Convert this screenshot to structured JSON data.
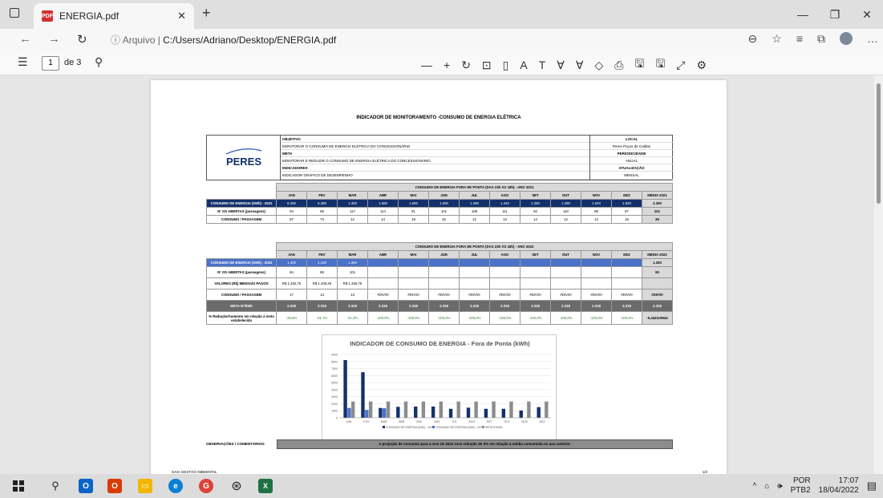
{
  "browser": {
    "tab_title": "ENERGIA.pdf",
    "url_prefix": "Arquivo",
    "url_path": "C:/Users/Adriano/Desktop/ENERGIA.pdf"
  },
  "pdf_toolbar": {
    "page_current": "1",
    "page_total": "de 3"
  },
  "document": {
    "title": "INDICADOR DE MONITORAMENTO -CONSUMO DE ENERGIA ELÉTRICA",
    "logo_text": "PERES",
    "header": {
      "objetivo_label": "OBJETIVO",
      "objetivo": "MONITORAR O CONSUMO DE ENERGIA ELÉTRICA DO CONCESSIONÁRIO",
      "meta_label": "META",
      "meta": "MONITORAR E REDUZIR O CONSUMO DE ENERGIA ELÉTRICA DO CONCESSIONÁRIO",
      "indicadores_label": "INDICADORES",
      "indicadores": "INDICADOR GRÁFICO DE DESEMPENHO",
      "local_label": "LOCAL",
      "local": "Peres Poços de Caldas",
      "periodicidade_label": "PERIODICIDADE",
      "periodicidade": "ANUAL",
      "atualizacao_label": "ATUALIZAÇÃO",
      "atualizacao": "MENSAL"
    },
    "table2021": {
      "caption": "CONSUMO DE ENERGIA FORA DE PONTA (DAS 23h ÀS 18h) - ANO 2021",
      "months": [
        "JAN",
        "FEV",
        "MAR",
        "ABR",
        "MAI",
        "JUN",
        "JUL",
        "AGO",
        "SET",
        "OUT",
        "NOV",
        "DEZ",
        "MÉDIA 2021"
      ],
      "rows": [
        {
          "label": "CONSUMO DE ENERGIA (kWh) - 2021",
          "values": [
            "8.200",
            "6.480",
            "1.400",
            "1.560",
            "1.600",
            "1.600",
            "1.280",
            "1.440",
            "1.280",
            "1.280",
            "1.040",
            "1.520",
            "2.390"
          ]
        },
        {
          "label": "Nº OS ABERTAS (passagens)",
          "values": [
            "94",
            "89",
            "117",
            "114",
            "91",
            "101",
            "108",
            "111",
            "92",
            "110",
            "88",
            "97",
            "101"
          ]
        },
        {
          "label": "CONSUMO / PASSAGEM",
          "values": [
            "87",
            "73",
            "12",
            "14",
            "18",
            "16",
            "12",
            "13",
            "14",
            "12",
            "12",
            "16",
            "25"
          ]
        }
      ]
    },
    "table2022": {
      "caption": "CONSUMO DE ENERGIA FORA DE PONTA (DAS 23h ÀS 18h) - ANO 2022",
      "months": [
        "JAN",
        "FEV",
        "MAR",
        "ABR",
        "MAI",
        "JUN",
        "JUL",
        "AGO",
        "SET",
        "OUT",
        "NOV",
        "DEZ",
        "MÉDIA 2022"
      ],
      "rows": [
        {
          "label": "CONSUMO DE ENERGIA (kWh) - 2022",
          "values": [
            "1.400",
            "1.120",
            "1.360",
            "",
            "",
            "",
            "",
            "",
            "",
            "",
            "",
            "",
            "1.293"
          ]
        },
        {
          "label": "Nº OS ABERTAS (passagens)",
          "values": [
            "84",
            "85",
            "101",
            "",
            "",
            "",
            "",
            "",
            "",
            "",
            "",
            "",
            "90"
          ]
        },
        {
          "label": "VALORES (R$) MENSAIS PAGOS",
          "values": [
            "R$ 1.482,70",
            "R$ 1.209,26",
            "R$ 1.455,76",
            "",
            "",
            "",
            "",
            "",
            "",
            "",
            "",
            "",
            ""
          ]
        },
        {
          "label": "CONSUMO / PASSAGEM",
          "values": [
            "17",
            "13",
            "13",
            "#DIV/0!",
            "#DIV/0!",
            "#DIV/0!",
            "#DIV/0!",
            "#DIV/0!",
            "#DIV/0!",
            "#DIV/0!",
            "#DIV/0!",
            "#DIV/0!",
            "#DIV/0!"
          ]
        },
        {
          "label": "META Nº/kWh",
          "values": [
            "2.318",
            "2.318",
            "2.318",
            "2.318",
            "2.318",
            "2.318",
            "2.318",
            "2.318",
            "2.318",
            "2.318",
            "2.318",
            "2.318",
            "2.318"
          ]
        },
        {
          "label": "% Redução/Aumento em relação à meta estabelecida",
          "values": [
            "-39,6%",
            "-51,7%",
            "-41,3%",
            "-100,0%",
            "-100,0%",
            "-100,0%",
            "-100,0%",
            "-100,0%",
            "-100,0%",
            "-100,0%",
            "-100,0%",
            "-100,0%",
            "-0,442119944"
          ]
        }
      ]
    },
    "observacoes_label": "OBSERVAÇÕES / COMENTÁRIOS:",
    "observacoes": "A projeção de consumo para o Ano de 2022 será redução de 3% em relação à média consumida no ano anterior.",
    "footer": "GAIA GESTÃO AMBIENTAL",
    "page_number": "1/3"
  },
  "chart_data": {
    "type": "bar",
    "title": "INDICADOR DE CONSUMO DE ENERGIA - Fora de Ponta (kWh)",
    "categories": [
      "JAN",
      "FEV",
      "MAR",
      "ABR",
      "MAI",
      "JUN",
      "JUL",
      "AGO",
      "SET",
      "OUT",
      "NOV",
      "DEZ"
    ],
    "ylim": [
      0,
      9000
    ],
    "yticks": [
      "0",
      "1000",
      "2000",
      "3000",
      "4000",
      "5000",
      "6000",
      "7000",
      "8000",
      "9000"
    ],
    "series": [
      {
        "name": "CONSUMO DE ENERGIA (kWh) - 2021",
        "color": "#13306b",
        "values": [
          8200,
          6480,
          1400,
          1560,
          1600,
          1600,
          1280,
          1440,
          1280,
          1280,
          1040,
          1520
        ]
      },
      {
        "name": "CONSUMO DE ENERGIA (kWh) - 2022",
        "color": "#4a72c8",
        "values": [
          1400,
          1120,
          1360,
          0,
          0,
          0,
          0,
          0,
          0,
          0,
          0,
          0
        ]
      },
      {
        "name": "META Nº/kWh",
        "color": "#8c8c8c",
        "values": [
          2318,
          2318,
          2318,
          2318,
          2318,
          2318,
          2318,
          2318,
          2318,
          2318,
          2318,
          2318
        ]
      }
    ]
  },
  "taskbar": {
    "lang1": "POR",
    "lang2": "PTB2",
    "time": "17:07",
    "date": "18/04/2022"
  }
}
